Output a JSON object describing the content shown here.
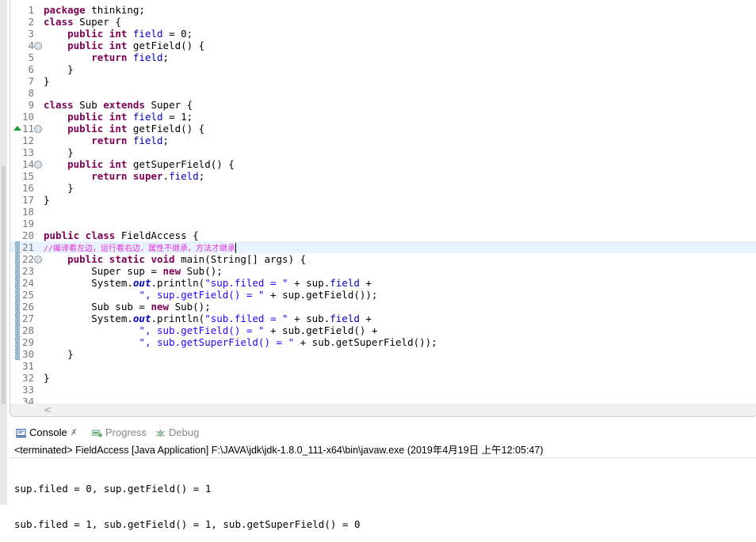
{
  "editor": {
    "current_line": 21,
    "lines": [
      [
        [
          "k",
          "package"
        ],
        [
          "p",
          " thinking;"
        ]
      ],
      [
        [
          "k",
          "class"
        ],
        [
          "p",
          " Super {"
        ]
      ],
      [
        [
          "p",
          "    "
        ],
        [
          "k",
          "public int"
        ],
        [
          "p",
          " "
        ],
        [
          "f",
          "field"
        ],
        [
          "p",
          " = 0;"
        ]
      ],
      [
        [
          "p",
          "    "
        ],
        [
          "k",
          "public int"
        ],
        [
          "p",
          " getField() {"
        ]
      ],
      [
        [
          "p",
          "        "
        ],
        [
          "k",
          "return"
        ],
        [
          "p",
          " "
        ],
        [
          "f",
          "field"
        ],
        [
          "p",
          ";"
        ]
      ],
      [
        [
          "p",
          "    }"
        ]
      ],
      [
        [
          "p",
          "}"
        ]
      ],
      [],
      [
        [
          "k",
          "class"
        ],
        [
          "p",
          " Sub "
        ],
        [
          "k",
          "extends"
        ],
        [
          "p",
          " Super {"
        ]
      ],
      [
        [
          "p",
          "    "
        ],
        [
          "k",
          "public int"
        ],
        [
          "p",
          " "
        ],
        [
          "f",
          "field"
        ],
        [
          "p",
          " = 1;"
        ]
      ],
      [
        [
          "p",
          "    "
        ],
        [
          "k",
          "public int"
        ],
        [
          "p",
          " getField() {"
        ]
      ],
      [
        [
          "p",
          "        "
        ],
        [
          "k",
          "return"
        ],
        [
          "p",
          " "
        ],
        [
          "f",
          "field"
        ],
        [
          "p",
          ";"
        ]
      ],
      [
        [
          "p",
          "    }"
        ]
      ],
      [
        [
          "p",
          "    "
        ],
        [
          "k",
          "public int"
        ],
        [
          "p",
          " getSuperField() {"
        ]
      ],
      [
        [
          "p",
          "        "
        ],
        [
          "k",
          "return super"
        ],
        [
          "p",
          "."
        ],
        [
          "f",
          "field"
        ],
        [
          "p",
          ";"
        ]
      ],
      [
        [
          "p",
          "    }"
        ]
      ],
      [
        [
          "p",
          "}"
        ]
      ],
      [],
      [],
      [
        [
          "k",
          "public class"
        ],
        [
          "p",
          " FieldAccess {"
        ]
      ],
      [
        [
          "c",
          "//编译看左边，运行看右边，属性不继承，方法才继承"
        ]
      ],
      [
        [
          "p",
          "    "
        ],
        [
          "k",
          "public static void"
        ],
        [
          "p",
          " main(String[] args) {"
        ]
      ],
      [
        [
          "p",
          "        Super "
        ],
        [
          "p",
          "sup"
        ],
        [
          "p",
          " = "
        ],
        [
          "k",
          "new"
        ],
        [
          "p",
          " Sub();"
        ]
      ],
      [
        [
          "p",
          "        System."
        ],
        [
          "i",
          "out"
        ],
        [
          "p",
          ".println("
        ],
        [
          "s",
          "\"sup.filed = \""
        ],
        [
          "p",
          " + sup."
        ],
        [
          "f",
          "field"
        ],
        [
          "p",
          " +"
        ]
      ],
      [
        [
          "p",
          "                "
        ],
        [
          "s",
          "\", sup.getField() = \""
        ],
        [
          "p",
          " + sup.getField());"
        ]
      ],
      [
        [
          "p",
          "        Sub sub = "
        ],
        [
          "k",
          "new"
        ],
        [
          "p",
          " Sub();"
        ]
      ],
      [
        [
          "p",
          "        System."
        ],
        [
          "i",
          "out"
        ],
        [
          "p",
          ".println("
        ],
        [
          "s",
          "\"sub.filed = \""
        ],
        [
          "p",
          " + sub."
        ],
        [
          "f",
          "field"
        ],
        [
          "p",
          " +"
        ]
      ],
      [
        [
          "p",
          "                "
        ],
        [
          "s",
          "\", sub.getField() = \""
        ],
        [
          "p",
          " + sub.getField() +"
        ]
      ],
      [
        [
          "p",
          "                "
        ],
        [
          "s",
          "\", sub.getSuperField() = \""
        ],
        [
          "p",
          " + sub.getSuperField());"
        ]
      ],
      [
        [
          "p",
          "    }"
        ]
      ],
      [],
      [
        [
          "p",
          "}"
        ]
      ],
      [],
      []
    ],
    "fold_lines": [
      4,
      11,
      14,
      22
    ],
    "override_lines": [
      11
    ],
    "marked_lines": [
      21,
      22,
      23,
      24,
      25,
      26,
      27,
      28,
      29,
      30
    ],
    "scroll_left_arrow": "<"
  },
  "console": {
    "tabs": [
      {
        "label": "Console",
        "icon": "console-icon",
        "close": "✗",
        "active": true
      },
      {
        "label": "Progress",
        "icon": "progress-icon",
        "active": false
      },
      {
        "label": "Debug",
        "icon": "debug-icon",
        "active": false
      }
    ],
    "status": "<terminated> FieldAccess [Java Application] F:\\JAVA\\jdk\\jdk-1.8.0_111-x64\\bin\\javaw.exe (2019年4月19日 上午12:05:47)",
    "output": [
      "sup.filed = 0, sup.getField() = 1",
      "sub.filed = 1, sub.getField() = 1, sub.getSuperField() = 0"
    ]
  }
}
